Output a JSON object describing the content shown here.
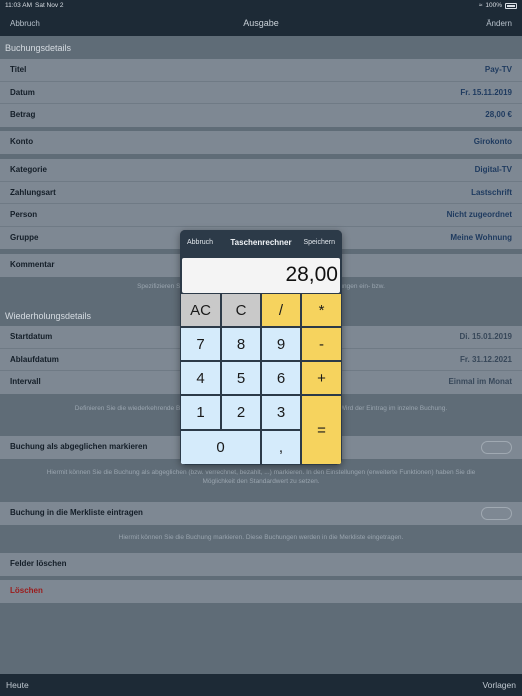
{
  "status": {
    "time": "11:03 AM",
    "date": "Sat Nov 2",
    "battery": "100%"
  },
  "nav": {
    "left": "Abbruch",
    "title": "Ausgabe",
    "right": "Ändern"
  },
  "sections": {
    "buchungsdetails": "Buchungsdetails",
    "wiederholung": "Wiederholungsdetails"
  },
  "rows": {
    "titel": {
      "label": "Titel",
      "value": "Pay-TV"
    },
    "datum": {
      "label": "Datum",
      "value": "Fr. 15.11.2019"
    },
    "betrag": {
      "label": "Betrag",
      "value": "28,00 €"
    },
    "konto": {
      "label": "Konto",
      "value": "Girokonto"
    },
    "kategorie": {
      "label": "Kategorie",
      "value": "Digital-TV"
    },
    "zahlungsart": {
      "label": "Zahlungsart",
      "value": "Lastschrift"
    },
    "person": {
      "label": "Person",
      "value": "Nicht zugeordnet"
    },
    "gruppe": {
      "label": "Gruppe",
      "value": "Meine Wohnung"
    },
    "kommentar": {
      "label": "Kommentar"
    },
    "startdatum": {
      "label": "Startdatum",
      "value": "Di. 15.01.2019"
    },
    "ablaufdatum": {
      "label": "Ablaufdatum",
      "value": "Fr. 31.12.2021"
    },
    "intervall": {
      "label": "Intervall",
      "value": "Einmal im Monat"
    },
    "abgeglichen": {
      "label": "Buchung als abgeglichen markieren"
    },
    "merkliste": {
      "label": "Buchung in die Merkliste eintragen"
    },
    "felder": {
      "label": "Felder löschen"
    },
    "loeschen": {
      "label": "Löschen"
    }
  },
  "hints": {
    "kommentar": "Spezifizieren Sie hier Ihre Buchung. Die Fel                                                                                    können Sie in den Einstellungen ein- bzw.",
    "wiederholung": "Definieren Sie die wiederkehrende Buchung. S                                                                                 ert löschen oder zum Tagesdatum beenden. Wird der Eintrag im                                                                                 inzelne Buchung.",
    "abgeglichen": "Hiermit können Sie die Buchung als abgeglichen (bzw. verrechnet, bezahlt, ...) markieren. In den Einstellungen (erweiterte Funktionen) haben Sie die Möglichkeit den Standardwert zu setzen.",
    "merkliste": "Hiermit können Sie die Buchung markieren. Diese Buchungen werden in die Merkliste eingetragen."
  },
  "bottom": {
    "left": "Heute",
    "right": "Vorlagen"
  },
  "calculator": {
    "cancel": "Abbruch",
    "title": "Taschenrechner",
    "save": "Speichern",
    "display": "28,00",
    "keys": {
      "ac": "AC",
      "c": "C",
      "divide": "/",
      "multiply": "*",
      "seven": "7",
      "eight": "8",
      "nine": "9",
      "minus": "-",
      "four": "4",
      "five": "5",
      "six": "6",
      "plus": "+",
      "one": "1",
      "two": "2",
      "three": "3",
      "equals": "=",
      "zero": "0",
      "comma": ","
    }
  },
  "colors": {
    "accent": "#1e3a5f",
    "operator": "#f6d35e",
    "digit": "#d5ebfb",
    "function": "#c9c9c9",
    "danger": "#9b1b1b"
  }
}
